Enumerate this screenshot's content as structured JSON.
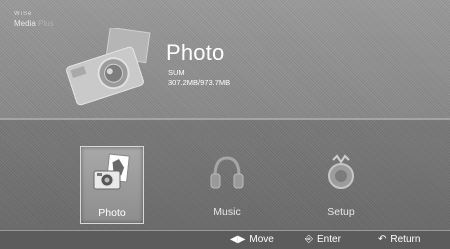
{
  "header": {
    "brand_logo": "WiSe",
    "brand_text": "Media",
    "brand_suffix": "Plus",
    "section_title": "Photo",
    "device_name": "SUM",
    "storage": "307.2MB/973.7MB"
  },
  "menu": {
    "items": [
      {
        "label": "Photo",
        "icon": "photo-icon",
        "selected": true
      },
      {
        "label": "Music",
        "icon": "headphones-icon",
        "selected": false
      },
      {
        "label": "Setup",
        "icon": "setup-icon",
        "selected": false
      }
    ]
  },
  "help": {
    "move_icon": "◀▶",
    "move": "Move",
    "enter_icon": "⎆",
    "enter": "Enter",
    "return_icon": "↶",
    "return": "Return"
  }
}
